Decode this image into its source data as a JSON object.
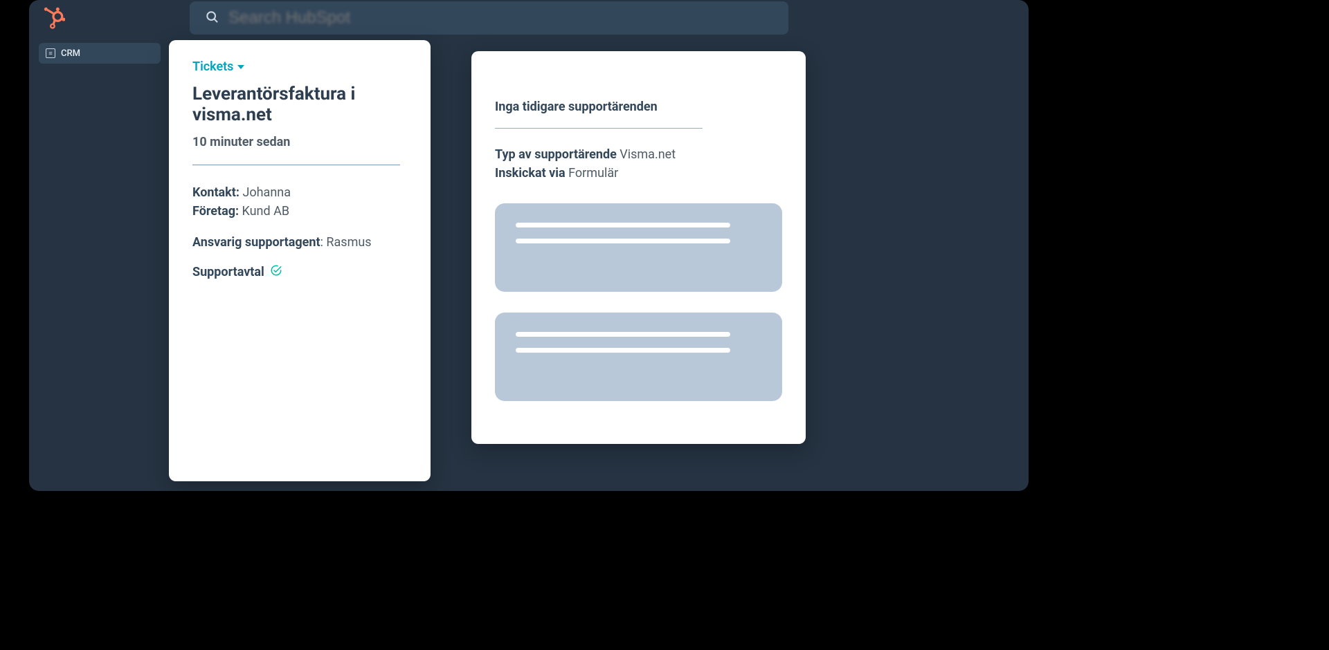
{
  "header": {
    "search_placeholder": "Search HubSpot"
  },
  "sidebar": {
    "items": [
      {
        "label": "CRM"
      }
    ]
  },
  "ticket": {
    "menu_label": "Tickets",
    "title": "Leverantörsfaktura i visma.net",
    "time": "10 minuter sedan",
    "contact_label": "Kontakt:",
    "contact_value": "Johanna",
    "company_label": "Företag:",
    "company_value": "Kund AB",
    "agent_label": "Ansvarig supportagent",
    "agent_sep": ": ",
    "agent_value": "Rasmus",
    "support_agreement_label": "Supportavtal"
  },
  "context": {
    "no_prev_label": "Inga tidigare supportärenden",
    "type_label": "Typ av supportärende",
    "type_value": "Visma.net",
    "submitted_label": "Inskickat via",
    "submitted_value": "Formulär"
  }
}
